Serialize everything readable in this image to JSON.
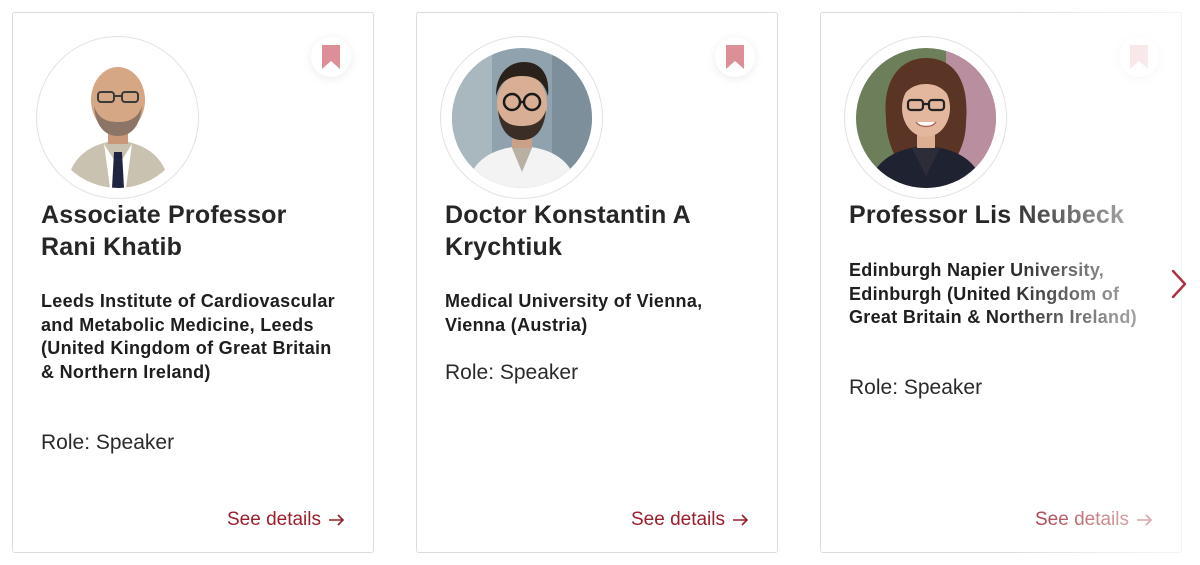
{
  "speakers": [
    {
      "name_line1": "Associate Professor",
      "name_line2": "Rani Khatib",
      "affiliation": "Leeds Institute of Cardiovascular and Metabolic Medicine, Leeds (United Kingdom of Great Britain & Northern Ireland)",
      "role": "Role: Speaker",
      "details_label": "See details",
      "bookmark_icon": "bookmark-icon"
    },
    {
      "name_line1": "Doctor Konstantin A",
      "name_line2": "Krychtiuk",
      "affiliation": "Medical University of Vienna, Vienna (Austria)",
      "role": "Role: Speaker",
      "details_label": "See details",
      "bookmark_icon": "bookmark-icon"
    },
    {
      "name_line1": "Professor Lis Neubeck",
      "name_line2": "",
      "affiliation": "Edinburgh Napier University, Edinburgh (United Kingdom of Great Britain & Northern Ireland)",
      "role": "Role: Speaker",
      "details_label": "See details",
      "bookmark_icon": "bookmark-icon"
    }
  ],
  "carousel": {
    "next_icon": "chevron-right-icon"
  },
  "colors": {
    "accent": "#9a1f2b",
    "bookmark": "#d98b93",
    "border": "#dcdcdc"
  }
}
